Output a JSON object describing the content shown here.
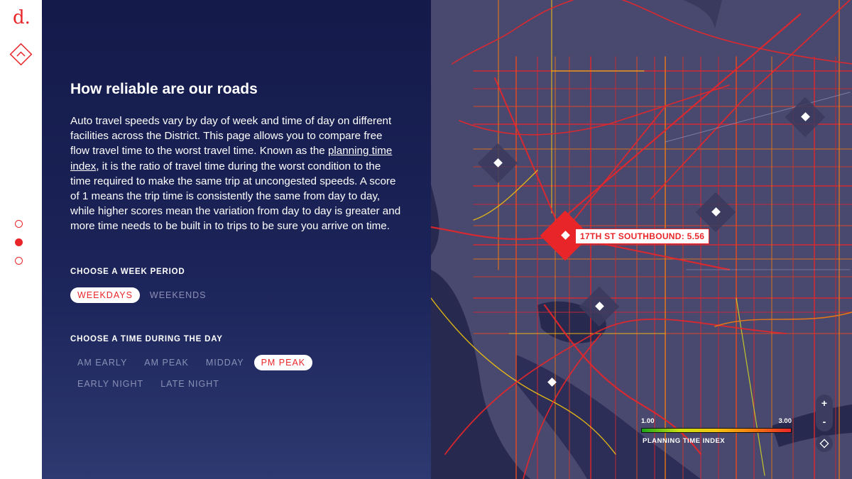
{
  "brand": {
    "logo_text": "d.",
    "accent": "#e8262a"
  },
  "nav": {
    "up_icon": "chevron-up-diamond-icon",
    "dots": 3,
    "active_dot": 1
  },
  "content": {
    "title": "How reliable are our roads",
    "body_before": "Auto travel speeds vary by day of week and time of day on different facilities across the District. This page allows you to compare free flow travel time to the worst travel time. Known as the ",
    "body_link": "planning time index",
    "body_after": ", it is the ratio of travel time during the worst condition to the time required to make the same trip at uncongested speeds. A score of 1 means the trip time is consistently the same from day to day, while higher scores mean the variation from day to day is greater and more time needs to be built in to trips to be sure you arrive on time."
  },
  "week_period": {
    "label": "CHOOSE A WEEK PERIOD",
    "options": [
      "WEEKDAYS",
      "WEEKENDS"
    ],
    "selected": "WEEKDAYS"
  },
  "time_of_day": {
    "label": "CHOOSE A TIME DURING THE DAY",
    "options": [
      "AM EARLY",
      "AM PEAK",
      "MIDDAY",
      "PM PEAK",
      "EARLY NIGHT",
      "LATE NIGHT"
    ],
    "selected": "PM PEAK"
  },
  "map": {
    "tooltip": "17TH ST SOUTHBOUND: 5.56",
    "legend": {
      "min": "1.00",
      "max": "3.00",
      "caption": "PLANNING TIME INDEX"
    },
    "zoom_in": "+",
    "zoom_out": "-",
    "colors": {
      "land": "#49486e",
      "water": "#27294e",
      "road_low": "#1aa51a",
      "road_high": "#e8262a"
    }
  }
}
